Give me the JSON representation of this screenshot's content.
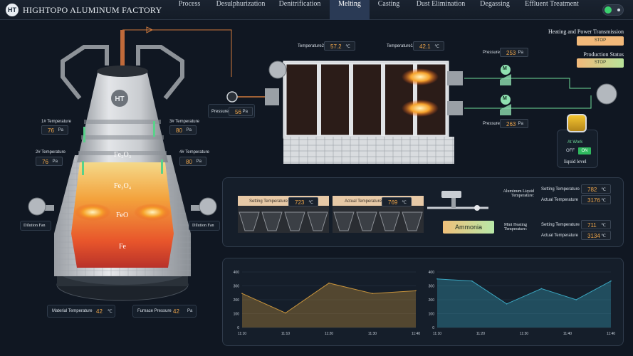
{
  "header": {
    "logo_text": "HT",
    "title": "HIGHTOPO ALUMINUM FACTORY",
    "nav": [
      {
        "label": "Process",
        "active": false
      },
      {
        "label": "Desulphurization",
        "active": false
      },
      {
        "label": "Denitrification",
        "active": false
      },
      {
        "label": "Melting",
        "active": true
      },
      {
        "label": "Casting",
        "active": false
      },
      {
        "label": "Dust Elimination",
        "active": false
      },
      {
        "label": "Degassing",
        "active": false
      },
      {
        "label": "Effluent Treatment",
        "active": false
      }
    ]
  },
  "furnace": {
    "logo_text": "HT",
    "layers": [
      "Fe₂O₃",
      "Fe₃O₄",
      "FeO",
      "Fe"
    ],
    "temp1": {
      "label": "1# Temperature",
      "value": "76",
      "unit": "Pa"
    },
    "temp2": {
      "label": "2# Temperature",
      "value": "76",
      "unit": "Pa"
    },
    "temp3": {
      "label": "3# Temperature",
      "value": "80",
      "unit": "Pa"
    },
    "temp4": {
      "label": "4# Temperature",
      "value": "80",
      "unit": "Pa"
    },
    "fan_left": "Dilution Fan",
    "fan_right": "Dilution Fan",
    "material_temp": {
      "label": "Material Temperature",
      "value": "42",
      "unit": "℃"
    },
    "furnace_pressure": {
      "label": "Furnace Pressure",
      "value": "42",
      "unit": "Pa"
    }
  },
  "pipe_pressure": {
    "label": "Pressure",
    "value": "56",
    "unit": "Pa"
  },
  "kiln": {
    "temp2": {
      "label": "Temperature2",
      "value": "57.2",
      "unit": "℃"
    },
    "temp1": {
      "label": "Temperature1",
      "value": "42.1",
      "unit": "℃"
    },
    "pressure_top": {
      "label": "Pressure",
      "value": "253",
      "unit": "Pa"
    },
    "pressure_bottom": {
      "label": "Pressure",
      "value": "263",
      "unit": "Pa"
    },
    "valve_label": "M"
  },
  "status": {
    "heating_title": "Heating and Power Transmission",
    "heating_btn": "STOP",
    "production_title": "Production Status",
    "production_btn": "STOP"
  },
  "liquid": {
    "status": "At Work",
    "off": "OFF",
    "on": "ON",
    "label": "liquid level"
  },
  "middle": {
    "setting_temp": {
      "label": "Setting Temperature",
      "value": "723",
      "unit": "℃"
    },
    "actual_temp": {
      "label": "Actual Temperature",
      "value": "769",
      "unit": "℃"
    },
    "ammonia": "Ammonia",
    "aluminum_title": "Aluminum Liquid Temperature:",
    "al_setting": {
      "label": "Setting Temperature",
      "value": "782",
      "unit": "℃"
    },
    "al_actual": {
      "label": "Actual Temperature",
      "value": "3176",
      "unit": "℃"
    },
    "mini_title": "Mini Heating Temperature:",
    "mini_setting": {
      "label": "Setting Temperature",
      "value": "711",
      "unit": "℃"
    },
    "mini_actual": {
      "label": "Actual Temperature",
      "value": "3134",
      "unit": "℃"
    }
  },
  "colors": {
    "accent_orange": "#f0a64a",
    "pipe_green": "#6fdc9a",
    "stop_btn": "#f2b97a",
    "active_tab": "#2a3a55"
  },
  "chart_data": [
    {
      "type": "area",
      "x": [
        "11:10",
        "11:10",
        "11:20",
        "11:30",
        "11:40"
      ],
      "values": [
        245,
        105,
        320,
        245,
        265
      ],
      "ylim": [
        0,
        400
      ],
      "yticks": [
        "0",
        "100",
        "200",
        "300",
        "400"
      ],
      "color": "#c8943c",
      "grid": true
    },
    {
      "type": "area",
      "x": [
        "11:10",
        "11:20",
        "11:30",
        "11:40",
        "11:40"
      ],
      "values": [
        350,
        335,
        170,
        280,
        200,
        335
      ],
      "ylim": [
        0,
        400
      ],
      "yticks": [
        "0",
        "100",
        "200",
        "300",
        "400"
      ],
      "color": "#3aa6c0",
      "grid": true
    }
  ]
}
